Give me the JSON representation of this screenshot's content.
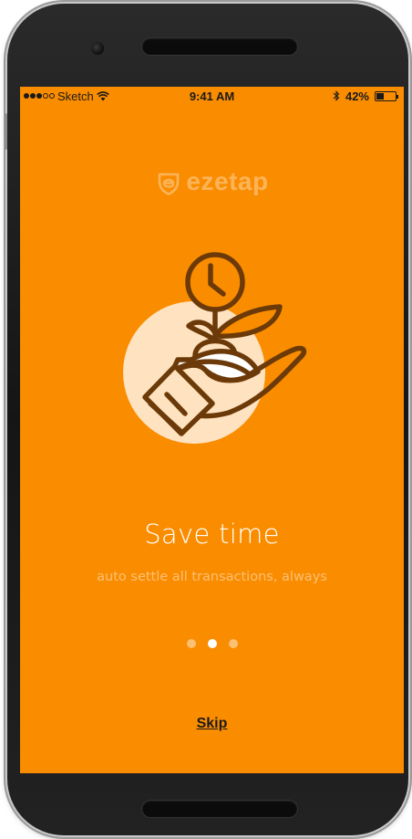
{
  "colors": {
    "accent": "#FA8C00",
    "icon_stroke": "#6B3A08",
    "icon_fill_light": "#FFE3C0"
  },
  "status_bar": {
    "carrier": "Sketch",
    "signal_strength": 3,
    "signal_max": 5,
    "time": "9:41 AM",
    "battery": "42%",
    "battery_level": 0.42,
    "icons": [
      "wifi-icon",
      "bluetooth-icon",
      "battery-icon"
    ]
  },
  "brand": {
    "name": "ezetap",
    "icon": "ezetap-logo-icon"
  },
  "onboarding": {
    "illustration": "hand-plant-clock-icon",
    "title": "Save time",
    "subtitle": "auto settle all transactions, always",
    "page_count": 3,
    "active_page": 2
  },
  "actions": {
    "skip_label": "Skip"
  }
}
